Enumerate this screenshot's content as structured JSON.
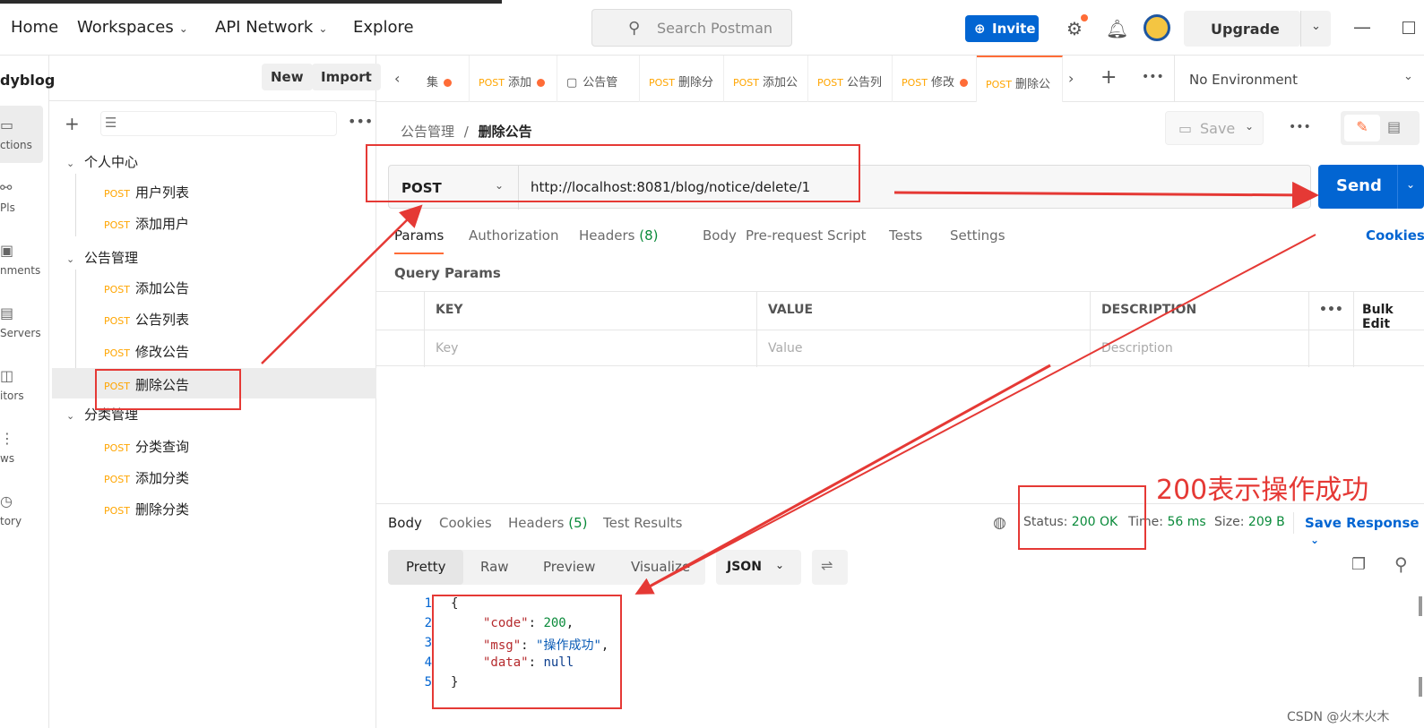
{
  "topbar": {
    "nav": [
      "Home",
      "Workspaces",
      "API Network",
      "Explore"
    ],
    "search_placeholder": "Search Postman",
    "invite": "Invite",
    "upgrade": "Upgrade"
  },
  "sidebar": {
    "workspace": "dyblog",
    "new": "New",
    "import": "Import",
    "rail": [
      "ctions",
      "Pls",
      "nments",
      "Servers",
      "itors",
      "ws",
      "tory"
    ],
    "folders": [
      {
        "name": "个人中心",
        "items": [
          "用户列表",
          "添加用户"
        ]
      },
      {
        "name": "公告管理",
        "items": [
          "添加公告",
          "公告列表",
          "修改公告",
          "删除公告"
        ]
      },
      {
        "name": "分类管理",
        "items": [
          "分类查询",
          "添加分类",
          "删除分类"
        ]
      }
    ],
    "method": "POST"
  },
  "tabs": [
    {
      "m": "",
      "label": "集",
      "dot": true
    },
    {
      "m": "POST",
      "label": "添加",
      "dot": true
    },
    {
      "m": "",
      "label": "公告管",
      "dot": false
    },
    {
      "m": "POST",
      "label": "删除分",
      "dot": false
    },
    {
      "m": "POST",
      "label": "添加公",
      "dot": false
    },
    {
      "m": "POST",
      "label": "公告列",
      "dot": false
    },
    {
      "m": "POST",
      "label": "修改",
      "dot": true
    },
    {
      "m": "POST",
      "label": "删除公",
      "dot": false
    }
  ],
  "environment": "No Environment",
  "breadcrumb": {
    "parent": "公告管理",
    "sep": "/",
    "current": "删除公告"
  },
  "save": "Save",
  "request": {
    "method": "POST",
    "url": "http://localhost:8081/blog/notice/delete/1",
    "send": "Send"
  },
  "req_tabs": {
    "params": "Params",
    "authorization": "Authorization",
    "headers": "Headers",
    "headers_count": "(8)",
    "body": "Body",
    "prerequest": "Pre-request Script",
    "tests": "Tests",
    "settings": "Settings",
    "cookies": "Cookies"
  },
  "query_params": "Query Params",
  "table": {
    "key": "KEY",
    "value": "VALUE",
    "description": "DESCRIPTION",
    "bulk": "Bulk Edit",
    "key_ph": "Key",
    "value_ph": "Value",
    "desc_ph": "Description"
  },
  "response": {
    "tabs": {
      "body": "Body",
      "cookies": "Cookies",
      "headers": "Headers",
      "headers_count": "(5)",
      "tests": "Test Results"
    },
    "status_label": "Status:",
    "status": "200 OK",
    "time_label": "Time:",
    "time": "56 ms",
    "size_label": "Size:",
    "size": "209 B",
    "save_response": "Save Response",
    "views": [
      "Pretty",
      "Raw",
      "Preview",
      "Visualize"
    ],
    "format": "JSON",
    "lines": [
      "1",
      "2",
      "3",
      "4",
      "5"
    ],
    "json": {
      "code_key": "\"code\"",
      "code_val": "200",
      "msg_key": "\"msg\"",
      "msg_val": "\"操作成功\"",
      "data_key": "\"data\"",
      "data_val": "null"
    }
  },
  "annotation": "200表示操作成功",
  "watermark": "CSDN @火木火木"
}
